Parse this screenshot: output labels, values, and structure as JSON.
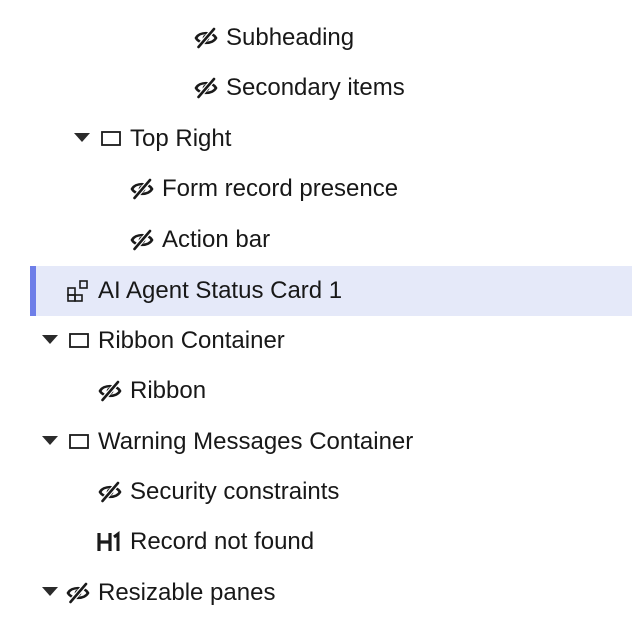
{
  "tree": {
    "items": [
      {
        "label": "Subheading",
        "icon": "eye-slash-icon",
        "expanded": null,
        "selected": false
      },
      {
        "label": "Secondary items",
        "icon": "eye-slash-icon",
        "expanded": null,
        "selected": false
      },
      {
        "label": "Top Right",
        "icon": "container-icon",
        "expanded": true,
        "selected": false
      },
      {
        "label": "Form record presence",
        "icon": "eye-slash-icon",
        "expanded": null,
        "selected": false
      },
      {
        "label": "Action bar",
        "icon": "eye-slash-icon",
        "expanded": null,
        "selected": false
      },
      {
        "label": "AI Agent Status Card 1",
        "icon": "component-icon",
        "expanded": null,
        "selected": true
      },
      {
        "label": "Ribbon Container",
        "icon": "container-icon",
        "expanded": true,
        "selected": false
      },
      {
        "label": "Ribbon",
        "icon": "eye-slash-icon",
        "expanded": null,
        "selected": false
      },
      {
        "label": "Warning Messages Container",
        "icon": "container-icon",
        "expanded": true,
        "selected": false
      },
      {
        "label": "Security constraints",
        "icon": "eye-slash-icon",
        "expanded": null,
        "selected": false
      },
      {
        "label": "Record not found",
        "icon": "heading-1-icon",
        "expanded": null,
        "selected": false
      },
      {
        "label": "Resizable panes",
        "icon": "eye-slash-icon",
        "expanded": true,
        "selected": false
      }
    ]
  },
  "colors": {
    "selected_background": "#e5e9f9",
    "selected_accent": "#6e7ee8",
    "text": "#181818"
  }
}
